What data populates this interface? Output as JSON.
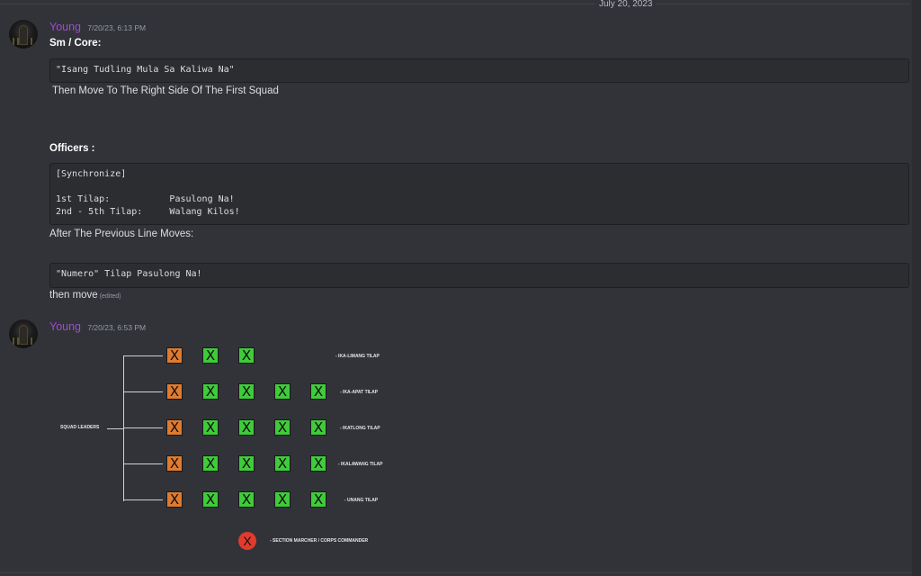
{
  "date_divider": "July 20, 2023",
  "messages": [
    {
      "username": "Young",
      "timestamp": "7/20/23, 6:13 PM",
      "heading1": "Sm / Core:",
      "code1": [
        "\"Isang Tudling Mula Sa Kaliwa Na\""
      ],
      "line1": "Then Move To The Right Side Of The First Squad",
      "heading2": "Officers :",
      "code2": [
        "[Synchronize]",
        "",
        "1st Tilap:           Pasulong Na!",
        "2nd - 5th Tilap:     Walang Kilos!"
      ],
      "line2": "After The Previous Line Moves:",
      "code3": [
        "\"Numero\" Tilap Pasulong Na!"
      ],
      "line3": "then move",
      "edited": "(edited)"
    },
    {
      "username": "Young",
      "timestamp": "7/20/23, 6:53 PM"
    }
  ],
  "diagram": {
    "box_glyph": "X",
    "leader_label": "SQUAD LEADERS",
    "rows": [
      {
        "label": "- IKA-LIMANG TILAP",
        "count": 3
      },
      {
        "label": "- IKA-APAT TILAP",
        "count": 5
      },
      {
        "label": "- IKATLONG TILAP",
        "count": 5
      },
      {
        "label": "- IKALAWANG TILAP",
        "count": 5
      },
      {
        "label": "- UNANG TILAP",
        "count": 5
      }
    ],
    "commander_label": "- SECTION MARCHER / CORPS COMMANDER",
    "colors": {
      "leader": "#e07a2e",
      "member": "#3fcb3a",
      "commander": "#e33a2e"
    }
  }
}
